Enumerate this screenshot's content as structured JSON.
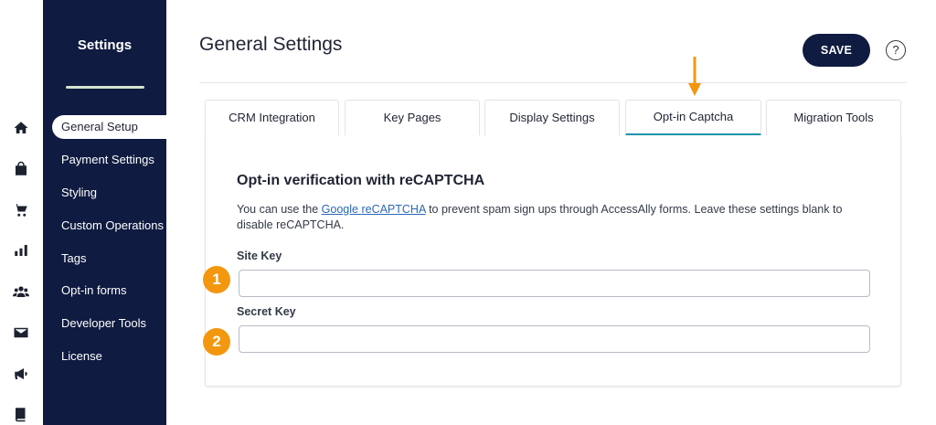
{
  "sidebar": {
    "title": "Settings",
    "items": [
      {
        "label": "General Setup",
        "active": true
      },
      {
        "label": "Payment Settings"
      },
      {
        "label": "Styling"
      },
      {
        "label": "Custom Operations"
      },
      {
        "label": "Tags"
      },
      {
        "label": "Opt-in forms"
      },
      {
        "label": "Developer Tools"
      },
      {
        "label": "License"
      }
    ]
  },
  "rail_icons": [
    "home-icon",
    "store-icon",
    "cart-icon",
    "bar-chart-icon",
    "users-icon",
    "mail-icon",
    "megaphone-icon",
    "book-icon"
  ],
  "header": {
    "title": "General Settings",
    "save_label": "SAVE",
    "help_label": "?"
  },
  "tabs": [
    {
      "label": "CRM Integration"
    },
    {
      "label": "Key Pages"
    },
    {
      "label": "Display Settings"
    },
    {
      "label": "Opt-in Captcha",
      "active": true
    },
    {
      "label": "Migration Tools"
    }
  ],
  "panel": {
    "heading": "Opt-in verification with reCAPTCHA",
    "desc_before": "You can use the ",
    "desc_link": "Google reCAPTCHA",
    "desc_after": " to prevent spam sign ups through AccessAlly forms. Leave these settings blank to disable reCAPTCHA.",
    "site_key_label": "Site Key",
    "site_key_value": "",
    "secret_key_label": "Secret Key",
    "secret_key_value": ""
  },
  "annotations": {
    "badge_1": "1",
    "badge_2": "2"
  },
  "colors": {
    "sidebar_bg": "#0f1b40",
    "accent_tab": "#1e94a9",
    "annotation_orange": "#f3970f",
    "link": "#2a69b6"
  }
}
